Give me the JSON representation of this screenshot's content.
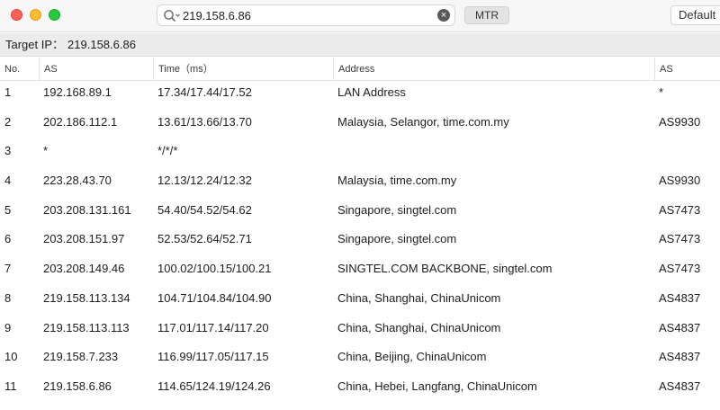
{
  "toolbar": {
    "search_value": "219.158.6.86",
    "clear_glyph": "×",
    "mtr_label": "MTR",
    "default_label": "Default"
  },
  "target": {
    "label": "Target IP：",
    "value": "219.158.6.86"
  },
  "columns": [
    "No.",
    "AS",
    "Time（ms）",
    "Address",
    "AS"
  ],
  "rows": [
    {
      "no": "1",
      "ip": "192.168.89.1",
      "time": "17.34/17.44/17.52",
      "address": "LAN Address",
      "as": "*"
    },
    {
      "no": "2",
      "ip": "202.186.112.1",
      "time": "13.61/13.66/13.70",
      "address": "Malaysia, Selangor, time.com.my",
      "as": "AS9930"
    },
    {
      "no": "3",
      "ip": "*",
      "time": "*/*/*",
      "address": "",
      "as": ""
    },
    {
      "no": "4",
      "ip": "223.28.43.70",
      "time": "12.13/12.24/12.32",
      "address": "Malaysia, time.com.my",
      "as": "AS9930"
    },
    {
      "no": "5",
      "ip": "203.208.131.161",
      "time": "54.40/54.52/54.62",
      "address": "Singapore, singtel.com",
      "as": "AS7473"
    },
    {
      "no": "6",
      "ip": "203.208.151.97",
      "time": "52.53/52.64/52.71",
      "address": "Singapore, singtel.com",
      "as": "AS7473"
    },
    {
      "no": "7",
      "ip": "203.208.149.46",
      "time": "100.02/100.15/100.21",
      "address": "SINGTEL.COM BACKBONE, singtel.com",
      "as": "AS7473"
    },
    {
      "no": "8",
      "ip": "219.158.113.134",
      "time": "104.71/104.84/104.90",
      "address": "China, Shanghai, ChinaUnicom",
      "as": "AS4837"
    },
    {
      "no": "9",
      "ip": "219.158.113.113",
      "time": "117.01/117.14/117.20",
      "address": "China, Shanghai, ChinaUnicom",
      "as": "AS4837"
    },
    {
      "no": "10",
      "ip": "219.158.7.233",
      "time": "116.99/117.05/117.15",
      "address": "China, Beijing, ChinaUnicom",
      "as": "AS4837"
    },
    {
      "no": "11",
      "ip": "219.158.6.86",
      "time": "114.65/124.19/124.26",
      "address": "China, Hebei, Langfang, ChinaUnicom",
      "as": "AS4837"
    }
  ],
  "icons": {
    "search": "search-icon",
    "clear": "clear-icon"
  },
  "colors": {
    "close": "#fe5f57",
    "minimize": "#febc2e",
    "maximize": "#28c840"
  }
}
